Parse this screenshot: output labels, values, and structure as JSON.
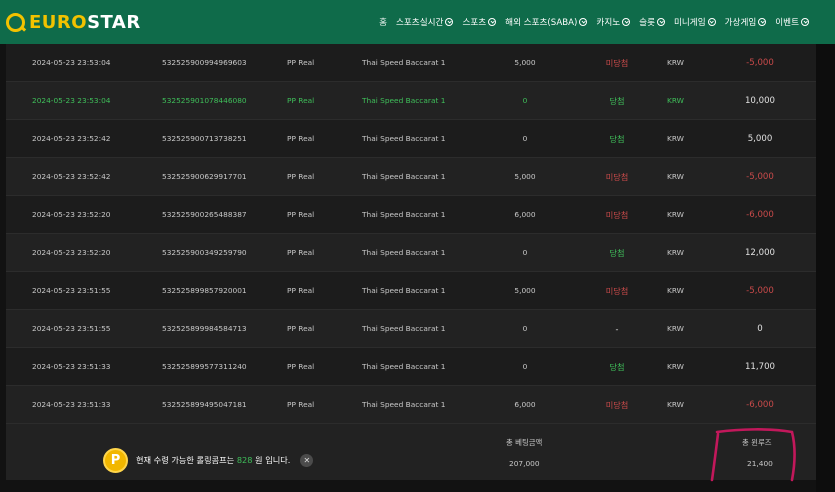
{
  "header": {
    "logo_prefix": "EURO",
    "logo_suffix": "STAR",
    "nav": [
      {
        "label": "홈",
        "has_menu": false
      },
      {
        "label": "스포츠실시간",
        "has_menu": true
      },
      {
        "label": "스포츠",
        "has_menu": true
      },
      {
        "label": "해외 스포츠(SABA)",
        "has_menu": true
      },
      {
        "label": "카지노",
        "has_menu": true
      },
      {
        "label": "슬롯",
        "has_menu": true
      },
      {
        "label": "미니게임",
        "has_menu": true
      },
      {
        "label": "가상게임",
        "has_menu": true
      },
      {
        "label": "이벤트",
        "has_menu": true
      }
    ]
  },
  "rows": [
    {
      "date": "2024-05-23 23:53:04",
      "id": "532525900994969603",
      "provider": "PP Real",
      "game": "Thai Speed Baccarat 1",
      "bet": "5,000",
      "result": "미당첨",
      "status": "lose",
      "currency": "KRW",
      "win_amount": "-5,000"
    },
    {
      "date": "2024-05-23 23:53:04",
      "id": "532525901078446080",
      "provider": "PP Real",
      "game": "Thai Speed Baccarat 1",
      "bet": "0",
      "result": "당첨",
      "status": "win",
      "currency": "KRW",
      "win_amount": "10,000"
    },
    {
      "date": "2024-05-23 23:52:42",
      "id": "532525900713738251",
      "provider": "PP Real",
      "game": "Thai Speed Baccarat 1",
      "bet": "0",
      "result": "당첨",
      "status": "win",
      "currency": "KRW",
      "win_amount": "5,000"
    },
    {
      "date": "2024-05-23 23:52:42",
      "id": "532525900629917701",
      "provider": "PP Real",
      "game": "Thai Speed Baccarat 1",
      "bet": "5,000",
      "result": "미당첨",
      "status": "lose",
      "currency": "KRW",
      "win_amount": "-5,000"
    },
    {
      "date": "2024-05-23 23:52:20",
      "id": "532525900265488387",
      "provider": "PP Real",
      "game": "Thai Speed Baccarat 1",
      "bet": "6,000",
      "result": "미당첨",
      "status": "lose",
      "currency": "KRW",
      "win_amount": "-6,000"
    },
    {
      "date": "2024-05-23 23:52:20",
      "id": "532525900349259790",
      "provider": "PP Real",
      "game": "Thai Speed Baccarat 1",
      "bet": "0",
      "result": "당첨",
      "status": "win",
      "currency": "KRW",
      "win_amount": "12,000"
    },
    {
      "date": "2024-05-23 23:51:55",
      "id": "532525899857920001",
      "provider": "PP Real",
      "game": "Thai Speed Baccarat 1",
      "bet": "5,000",
      "result": "미당첨",
      "status": "lose",
      "currency": "KRW",
      "win_amount": "-5,000"
    },
    {
      "date": "2024-05-23 23:51:55",
      "id": "532525899984584713",
      "provider": "PP Real",
      "game": "Thai Speed Baccarat 1",
      "bet": "0",
      "result": "-",
      "status": "none",
      "currency": "KRW",
      "win_amount": "0"
    },
    {
      "date": "2024-05-23 23:51:33",
      "id": "532525899577311240",
      "provider": "PP Real",
      "game": "Thai Speed Baccarat 1",
      "bet": "0",
      "result": "당첨",
      "status": "win",
      "currency": "KRW",
      "win_amount": "11,700"
    },
    {
      "date": "2024-05-23 23:51:33",
      "id": "532525899495047181",
      "provider": "PP Real",
      "game": "Thai Speed Baccarat 1",
      "bet": "6,000",
      "result": "미당첨",
      "status": "lose",
      "currency": "KRW",
      "win_amount": "-6,000"
    }
  ],
  "summary": {
    "total_bet_label": "총 베팅금액",
    "total_bet_value": "207,000",
    "total_win_label": "총 윈루즈",
    "total_win_value": "21,400"
  },
  "toast": {
    "coin_letter": "P",
    "text_before": "현재 수령 가능한 롤링콤프는 ",
    "amount": "828",
    "text_after": " 원 입니다.",
    "close_glyph": "✕"
  },
  "colors": {
    "header_bg": "#0f6b4a",
    "logo_accent": "#f2c200",
    "win_green": "#3fbf5a",
    "lose_red": "#c94a4a",
    "annotation_pink": "#c2185b"
  }
}
